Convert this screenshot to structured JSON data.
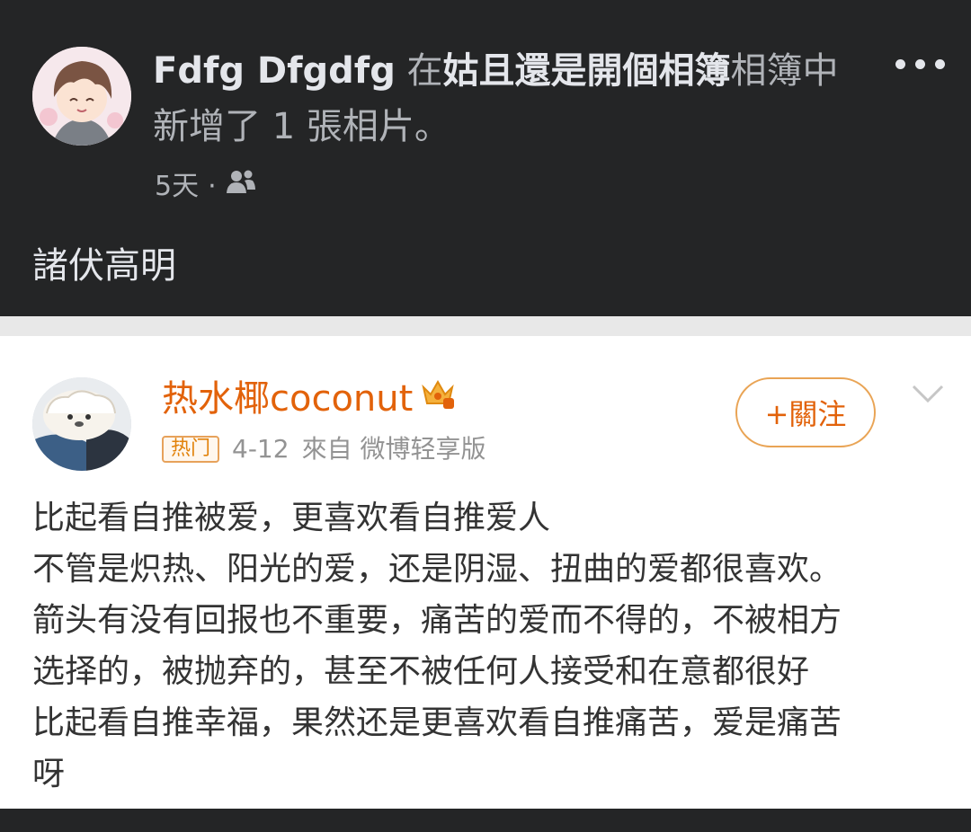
{
  "fb_post": {
    "author": "Fdfg Dfgdfg",
    "connector": "在",
    "album_name": "姑且還是開個相簿",
    "album_suffix": "相簿中",
    "action": "新增了 1 張相片。",
    "time": "5天",
    "dot": "·",
    "audience_icon": "friends-icon",
    "caption": "諸伏高明"
  },
  "weibo": {
    "username": "热水椰coconut",
    "badge_icon": "crown-badge-icon",
    "hot_label": "热门",
    "date": "4-12",
    "source": "來自 微博轻享版",
    "follow_label": "+關注",
    "body_lines": [
      "比起看自推被爱，更喜欢看自推爱人",
      "不管是炽热、阳光的爱，还是阴湿、扭曲的爱都很喜欢。",
      "箭头有没有回报也不重要，痛苦的爱而不得的，不被相方",
      "选择的，被抛弃的，甚至不被任何人接受和在意都很好",
      "比起看自推幸福，果然还是更喜欢看自推痛苦，爱是痛苦",
      "呀"
    ]
  },
  "colors": {
    "fb_bg": "#242526",
    "weibo_orange": "#e2620a",
    "weibo_text": "#333333"
  }
}
